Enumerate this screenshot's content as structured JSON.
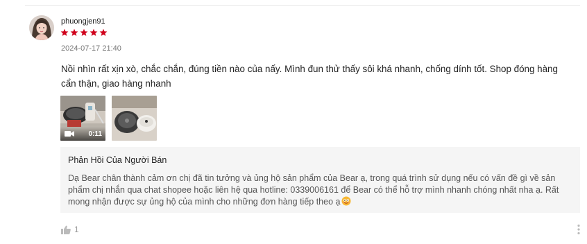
{
  "review": {
    "username": "phuongjen91",
    "rating": 5,
    "timestamp": "2024-07-17 21:40",
    "text": "Nồi nhìn rất xịn xò, chắc chắn, đúng tiền nào của nấy. Mình đun thử thấy sôi khá nhanh, chống dính tốt. Shop đóng hàng cẩn thận, giao hàng nhanh",
    "media": [
      {
        "type": "video",
        "duration": "0:11"
      },
      {
        "type": "image"
      }
    ],
    "like_count": "1"
  },
  "seller_response": {
    "title": "Phản Hồi Của Người Bán",
    "text": "Dạ Bear chân thành cảm ơn chị đã tin tưởng và ủng hộ sản phẩm của Bear ạ, trong quá trình sử dụng nếu có vấn đề gì về sản phẩm chị nhắn qua chat shopee hoặc liên hệ qua hotline: 0339006161 để Bear có thể hỗ trợ mình nhanh chóng nhất nha ạ. Rất mong nhận được sự ủng hộ của mình cho những đơn hàng tiếp theo ạ"
  },
  "colors": {
    "star": "#d0011b",
    "seller_bg": "#f5f5f5",
    "muted": "#999999"
  },
  "icons": {
    "star": "star-icon",
    "video": "video-camera-icon",
    "like": "thumbs-up-icon",
    "more": "more-vertical-icon"
  }
}
